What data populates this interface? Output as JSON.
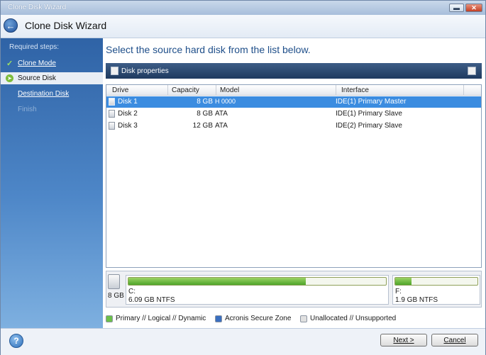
{
  "window": {
    "title": "Clone Disk Wizard"
  },
  "header": {
    "title": "Clone Disk Wizard"
  },
  "sidebar": {
    "heading": "Required steps:",
    "steps": [
      {
        "label": "Clone Mode",
        "state": "done"
      },
      {
        "label": "Source Disk",
        "state": "current"
      },
      {
        "label": "Destination Disk",
        "state": "next"
      },
      {
        "label": "Finish",
        "state": "disabled"
      }
    ]
  },
  "main": {
    "instruction": "Select the source hard disk from the list below.",
    "toolbar_label": "Disk properties"
  },
  "table": {
    "columns": [
      "Drive",
      "Capacity",
      "Model",
      "Interface"
    ],
    "rows": [
      {
        "drive": "Disk 1",
        "capacity": "8 GB",
        "model": "H 0000",
        "interface": "IDE(1) Primary Master",
        "selected": true
      },
      {
        "drive": "Disk 2",
        "capacity": "8 GB",
        "model": "ATA",
        "interface": "IDE(1) Primary Slave",
        "selected": false
      },
      {
        "drive": "Disk 3",
        "capacity": "12 GB",
        "model": "ATA",
        "interface": "IDE(2) Primary Slave",
        "selected": false
      }
    ]
  },
  "disk_map": {
    "disk_size": "8 GB",
    "partitions": [
      {
        "name": "C:",
        "info": "6.09 GB  NTFS",
        "used_fraction": 0.69
      },
      {
        "name": "F:",
        "info": "1.9 GB  NTFS",
        "used_fraction": 0.2
      }
    ]
  },
  "legend": [
    {
      "label": "Primary // Logical // Dynamic",
      "color": "#6cc04a"
    },
    {
      "label": "Acronis Secure Zone",
      "color": "#3a6fc0"
    },
    {
      "label": "Unallocated // Unsupported",
      "color": "#e0e0e0"
    }
  ],
  "footer": {
    "next_label": "Next >",
    "cancel_label": "Cancel"
  },
  "icons": {
    "back": "back-arrow-icon",
    "help": "help-icon",
    "minimize": "minimize-icon",
    "close": "close-icon"
  }
}
